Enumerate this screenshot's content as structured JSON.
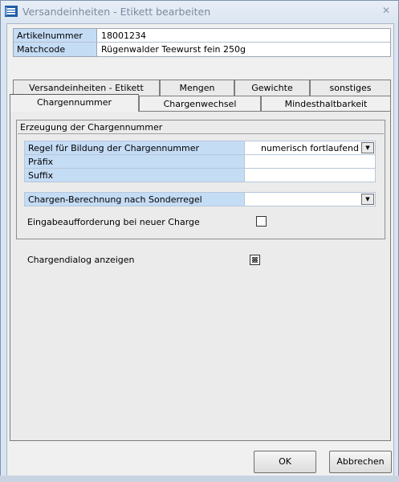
{
  "window": {
    "title": "Versandeinheiten - Etikett bearbeiten",
    "close_glyph": "✕"
  },
  "article": {
    "number_label": "Artikelnummer",
    "number_value": "18001234",
    "matchcode_label": "Matchcode",
    "matchcode_value": "Rügenwalder Teewurst fein 250g"
  },
  "tabs": {
    "back_row": [
      {
        "label": "Versandeinheiten - Etikett"
      },
      {
        "label": "Mengen"
      },
      {
        "label": "Gewichte"
      },
      {
        "label": "sonstiges"
      }
    ],
    "front_row": [
      {
        "label": "Chargennummer",
        "active": true
      },
      {
        "label": "Chargenwechsel"
      },
      {
        "label": "Mindesthaltbarkeit"
      }
    ]
  },
  "group": {
    "title": "Erzeugung der Chargennummer",
    "rule_label": "Regel für Bildung der Chargennummer",
    "rule_value": "numerisch fortlaufend",
    "prefix_label": "Präfix",
    "prefix_value": "",
    "suffix_label": "Suffix",
    "suffix_value": "",
    "special_rule_label": "Chargen-Berechnung nach Sonderregel",
    "special_rule_value": "",
    "prompt_label": "Eingabeaufforderung bei neuer Charge",
    "prompt_checked": false
  },
  "dialog_option": {
    "label": "Chargendialog anzeigen",
    "checked": true
  },
  "buttons": {
    "ok": "OK",
    "cancel": "Abbrechen"
  }
}
